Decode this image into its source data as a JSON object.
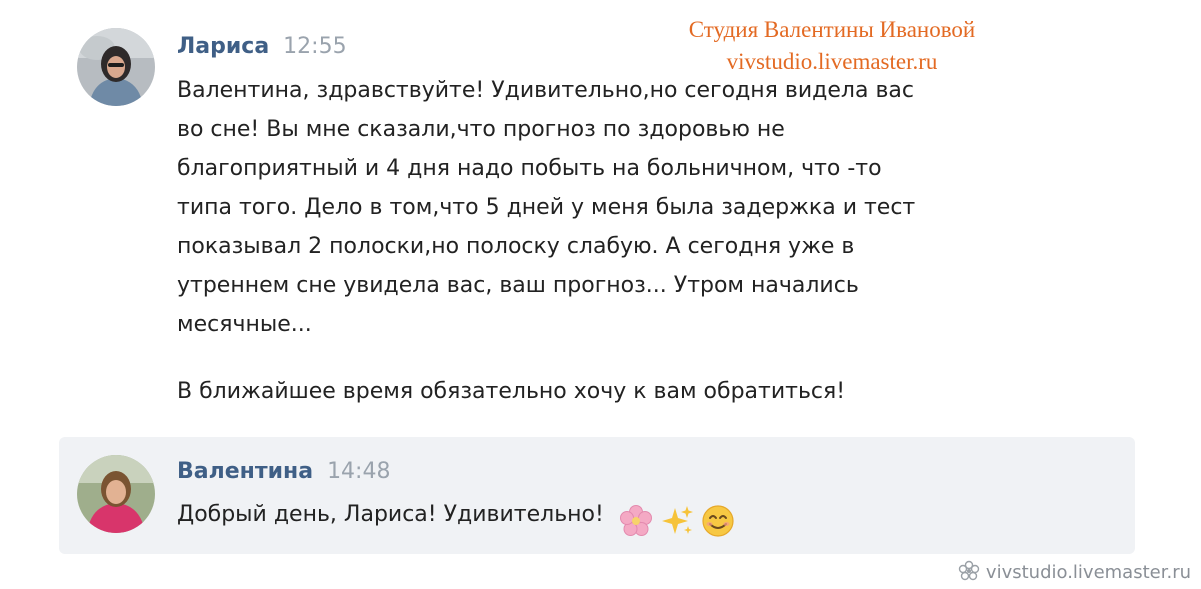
{
  "watermark": {
    "studio_name": "Студия Валентины Ивановой",
    "studio_url": "vivstudio.livemaster.ru",
    "footer_url": "vivstudio.livemaster.ru",
    "footer_icon": "flower-logo-icon"
  },
  "messages": [
    {
      "author": "Лариса",
      "time": "12:55",
      "lines": [
        "Валентина, здравствуйте! Удивительно,но сегодня видела вас",
        "во сне! Вы мне сказали,что прогноз по здоровью не",
        "благоприятный и 4 дня надо побыть на больничном, что -то",
        "типа того. Дело в том,что 5 дней у меня была задержка и тест",
        "показывал 2 полоски,но полоску слабую. А сегодня уже в",
        "утреннем сне увидела вас, ваш прогноз... Утром начались",
        "месячные..."
      ],
      "paragraph2": "В ближайшее время обязательно хочу к вам обратиться!"
    },
    {
      "author": "Валентина",
      "time": "14:48",
      "text": "Добрый день, Лариса! Удивительно!",
      "emojis": [
        "cherry-blossom-icon",
        "sparkles-icon",
        "smiling-face-icon"
      ]
    }
  ],
  "colors": {
    "author": "#3f5f86",
    "time": "#9aa3ad",
    "watermark": "#e36a23",
    "highlight_bg": "#f0f2f5"
  }
}
